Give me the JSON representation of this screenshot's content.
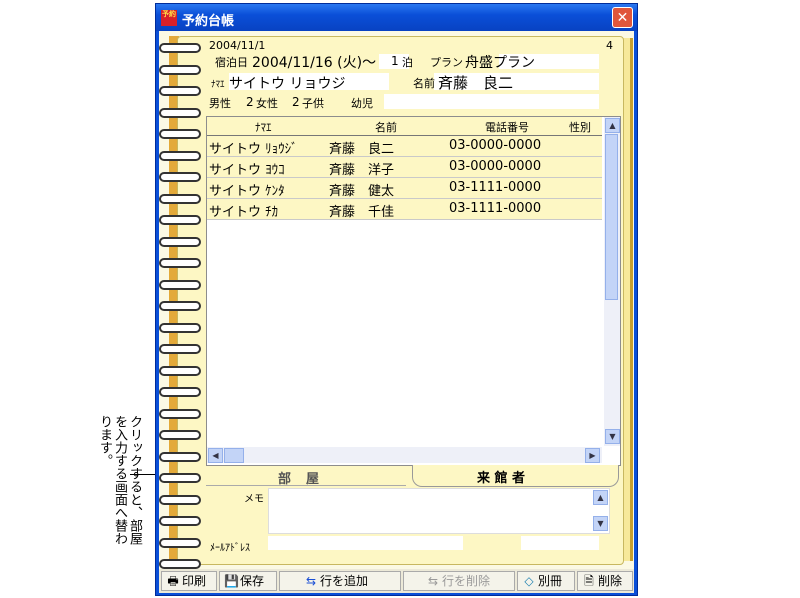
{
  "annotation": "クリックすると、部屋を入力する画面へ替わります。",
  "window": {
    "title": "予約台帳",
    "icon_text": "予約",
    "close_label": "✕"
  },
  "header": {
    "date": "2004/11/1",
    "page_number": "4",
    "stay_label": "宿泊日",
    "stay_value": "2004/11/16 (火)～",
    "nights_value": "1",
    "nights_unit": "泊",
    "plan_label": "プラン",
    "plan_value": "舟盛プラン",
    "kana_label": "ﾅﾏｴ",
    "kana_value": "サイトウ リョウジ",
    "name_label": "名前",
    "name_value": "斉藤　良二",
    "male_label": "男性",
    "male_value": "2",
    "female_label": "女性",
    "female_value": "2",
    "child_label": "子供",
    "infant_label": "幼児"
  },
  "grid": {
    "columns": [
      "ﾅﾏｴ",
      "名前",
      "電話番号",
      "性別"
    ],
    "rows": [
      {
        "kana": "サイトウ ﾘｮｳｼﾞ",
        "name": "斉藤　良二",
        "phone": "03-0000-0000"
      },
      {
        "kana": "サイトウ ﾖｳｺ",
        "name": "斉藤　洋子",
        "phone": "03-0000-0000"
      },
      {
        "kana": "サイトウ ｹﾝﾀ",
        "name": "斉藤　健太",
        "phone": "03-1111-0000"
      },
      {
        "kana": "サイトウ ﾁｶ",
        "name": "斉藤　千佳",
        "phone": "03-1111-0000"
      }
    ]
  },
  "tabs": {
    "room": "部　屋",
    "guest": "来 館 者"
  },
  "memo_label": "メモ",
  "email_label": "ﾒｰﾙｱﾄﾞﾚｽ",
  "toolbar": {
    "print": "印刷",
    "save": "保存",
    "add_row": "行を追加",
    "delete_row": "行を削除",
    "other": "別冊",
    "delete": "削除"
  }
}
